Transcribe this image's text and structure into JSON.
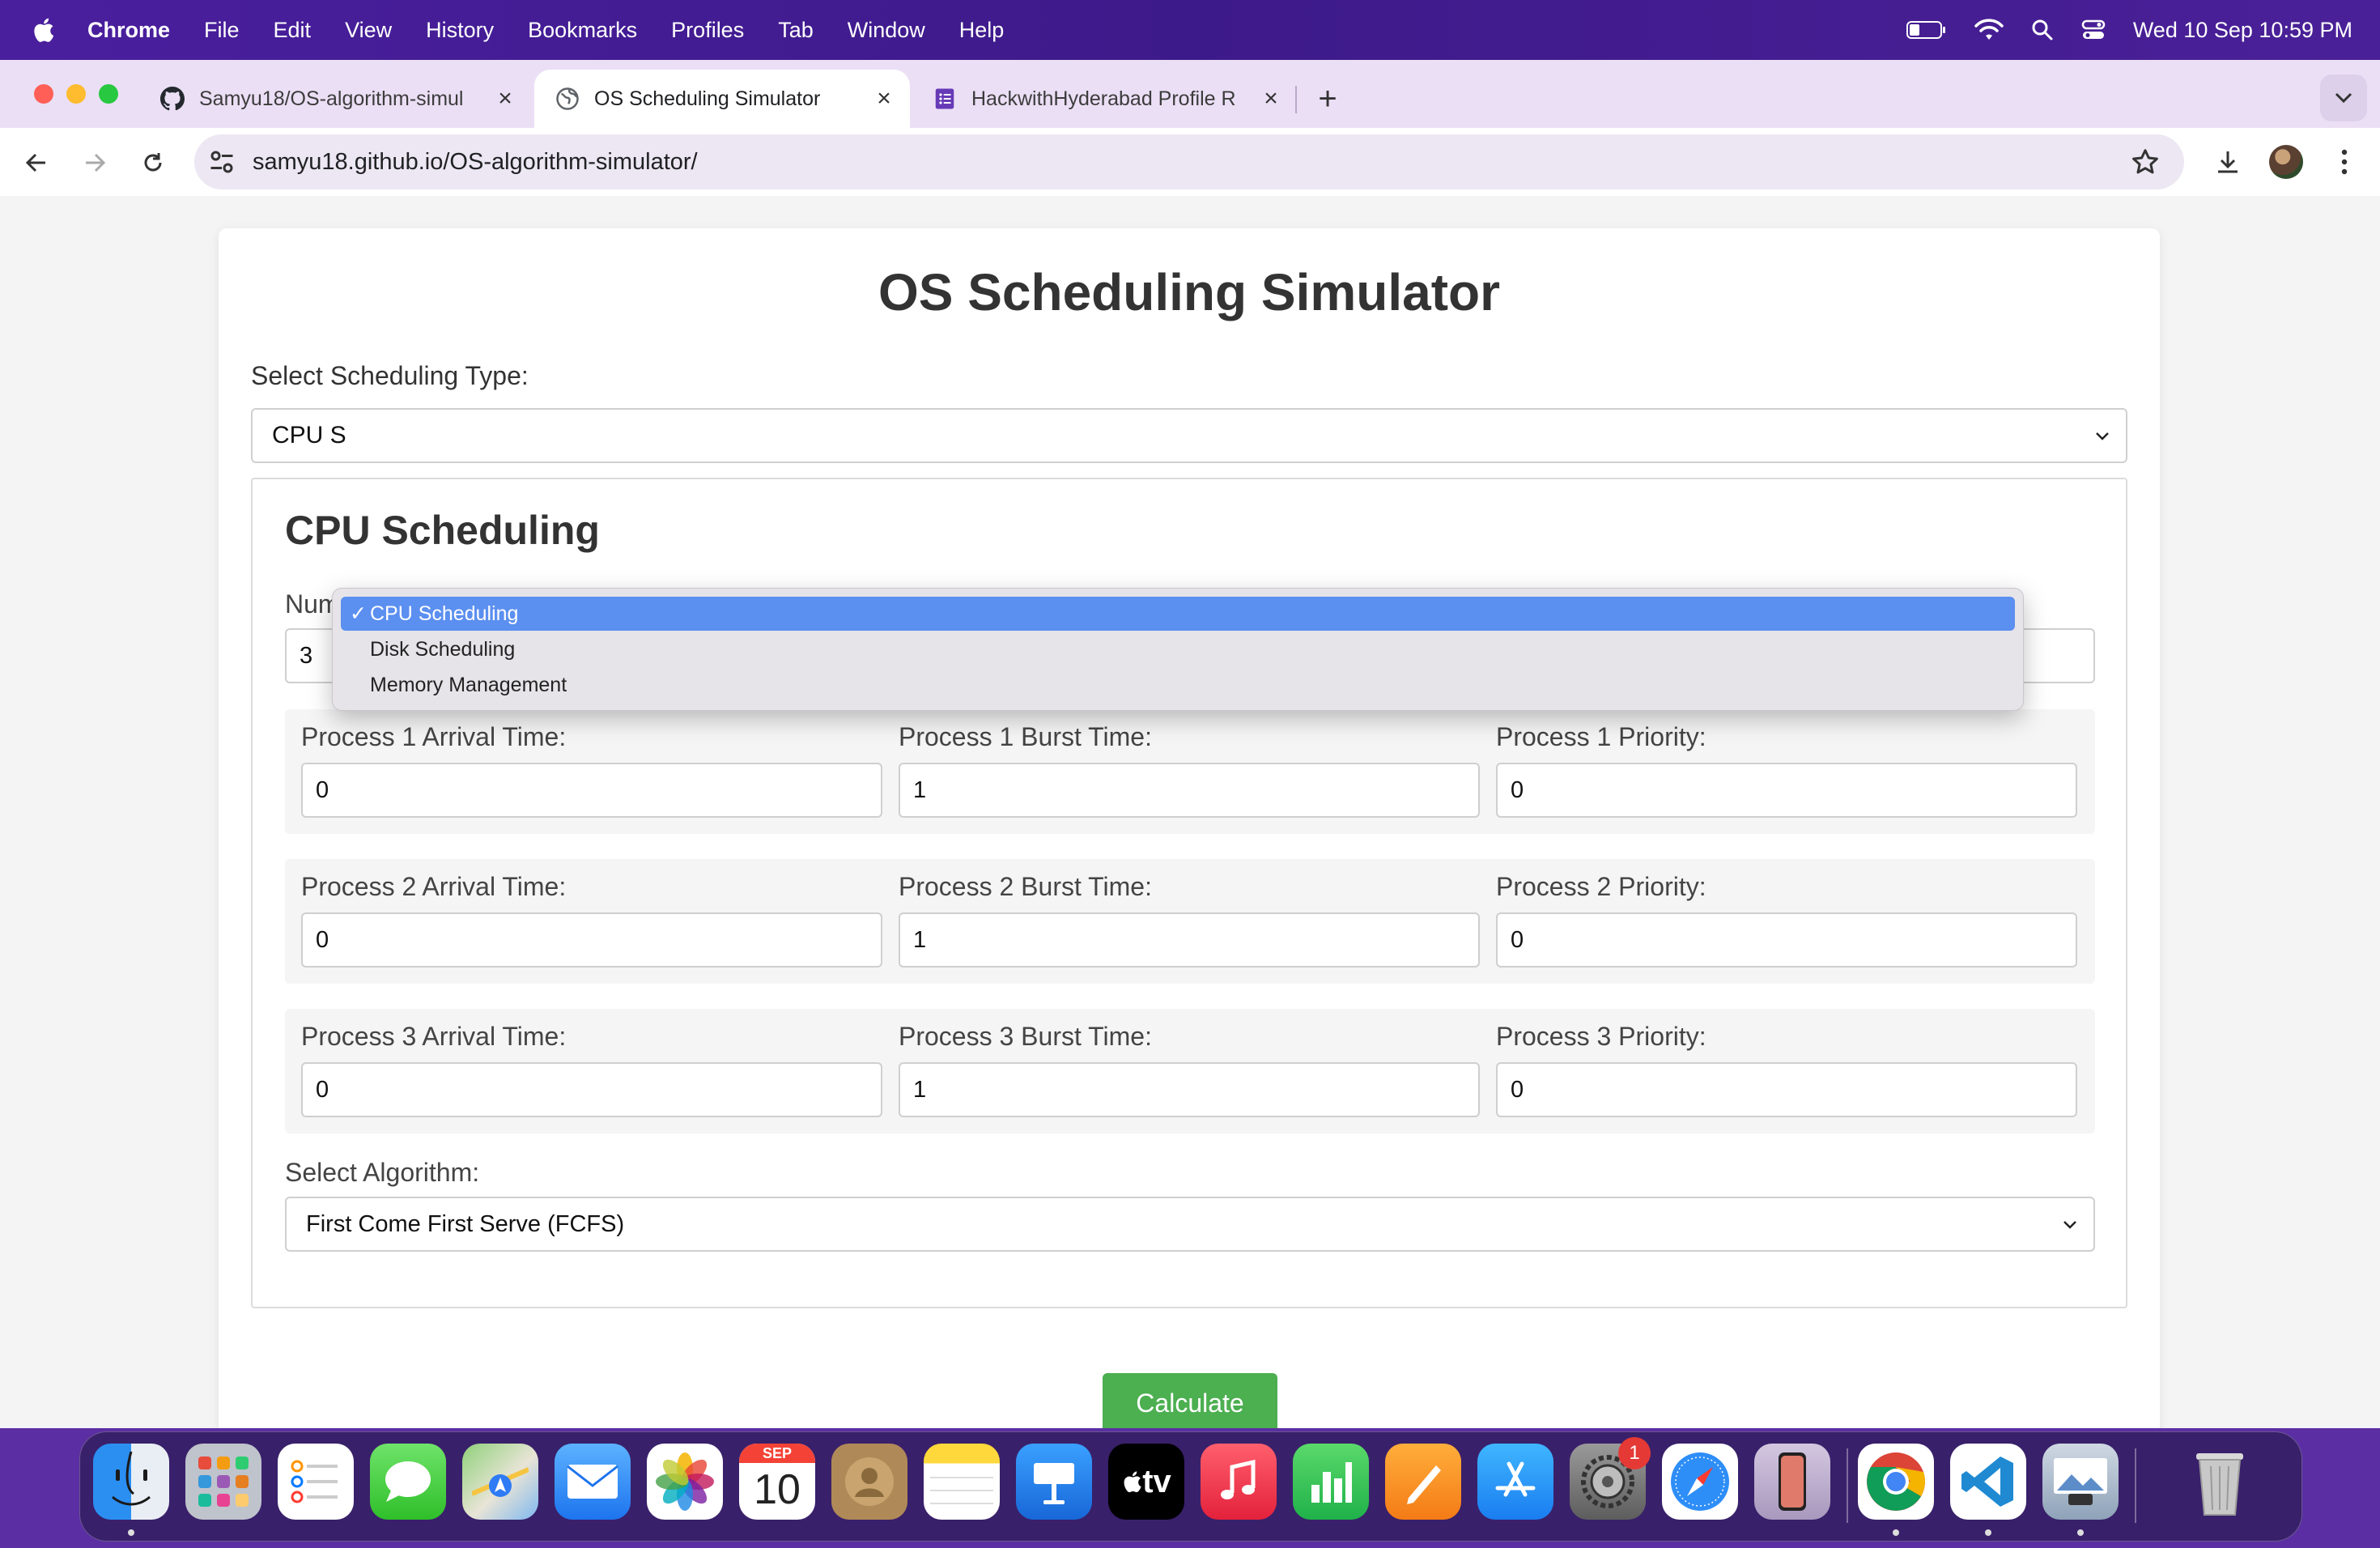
{
  "menubar": {
    "app_name": "Chrome",
    "items": [
      "File",
      "Edit",
      "View",
      "History",
      "Bookmarks",
      "Profiles",
      "Tab",
      "Window",
      "Help"
    ],
    "clock": "Wed 10 Sep  10:59 PM"
  },
  "tabs": [
    {
      "title": "Samyu18/OS-algorithm-simul",
      "icon": "github-icon",
      "active": false
    },
    {
      "title": "OS Scheduling Simulator",
      "icon": "globe-icon",
      "active": true
    },
    {
      "title": "HackwithHyderabad Profile R",
      "icon": "forms-icon",
      "active": false
    }
  ],
  "omnibox": {
    "url": "samyu18.github.io/OS-algorithm-simulator/"
  },
  "page": {
    "title": "OS Scheduling Simulator",
    "select_type_label": "Select Scheduling Type:",
    "select_type_value": "CPU Scheduling",
    "select_type_visible": "CPU S",
    "dropdown_options": [
      "CPU Scheduling",
      "Disk Scheduling",
      "Memory Management"
    ],
    "dropdown_selected_index": 0,
    "section_title": "CPU Scheduling",
    "num_processes_label": "Number of Processes:",
    "num_processes_value": "3",
    "processes": [
      {
        "arrival_label": "Process 1 Arrival Time:",
        "arrival": "0",
        "burst_label": "Process 1 Burst Time:",
        "burst": "1",
        "priority_label": "Process 1 Priority:",
        "priority": "0"
      },
      {
        "arrival_label": "Process 2 Arrival Time:",
        "arrival": "0",
        "burst_label": "Process 2 Burst Time:",
        "burst": "1",
        "priority_label": "Process 2 Priority:",
        "priority": "0"
      },
      {
        "arrival_label": "Process 3 Arrival Time:",
        "arrival": "0",
        "burst_label": "Process 3 Burst Time:",
        "burst": "1",
        "priority_label": "Process 3 Priority:",
        "priority": "0"
      }
    ],
    "algorithm_label": "Select Algorithm:",
    "algorithm_value": "First Come First Serve (FCFS)",
    "calculate_label": "Calculate"
  },
  "dock": {
    "apps": [
      "finder-icon",
      "launchpad-icon",
      "reminders-icon",
      "messages-icon",
      "maps-icon",
      "mail-icon",
      "photos-icon",
      "calendar-icon",
      "contacts-icon",
      "notes-icon",
      "keynote-icon",
      "apple-tv-icon",
      "music-icon",
      "numbers-icon",
      "pages-icon",
      "app-store-icon",
      "system-settings-icon",
      "safari-icon",
      "iphone-mirroring-icon",
      "chrome-icon",
      "vscode-icon",
      "preview-icon",
      "trash-icon"
    ],
    "calendar_month": "SEP",
    "calendar_day": "10",
    "settings_badge": "1",
    "appletv_label": "tv"
  },
  "colors": {
    "menubar": "#3d1a8a",
    "tabstrip": "#ebdff5",
    "select_highlight": "#5b8ff0",
    "calculate_button": "#4caf50"
  }
}
